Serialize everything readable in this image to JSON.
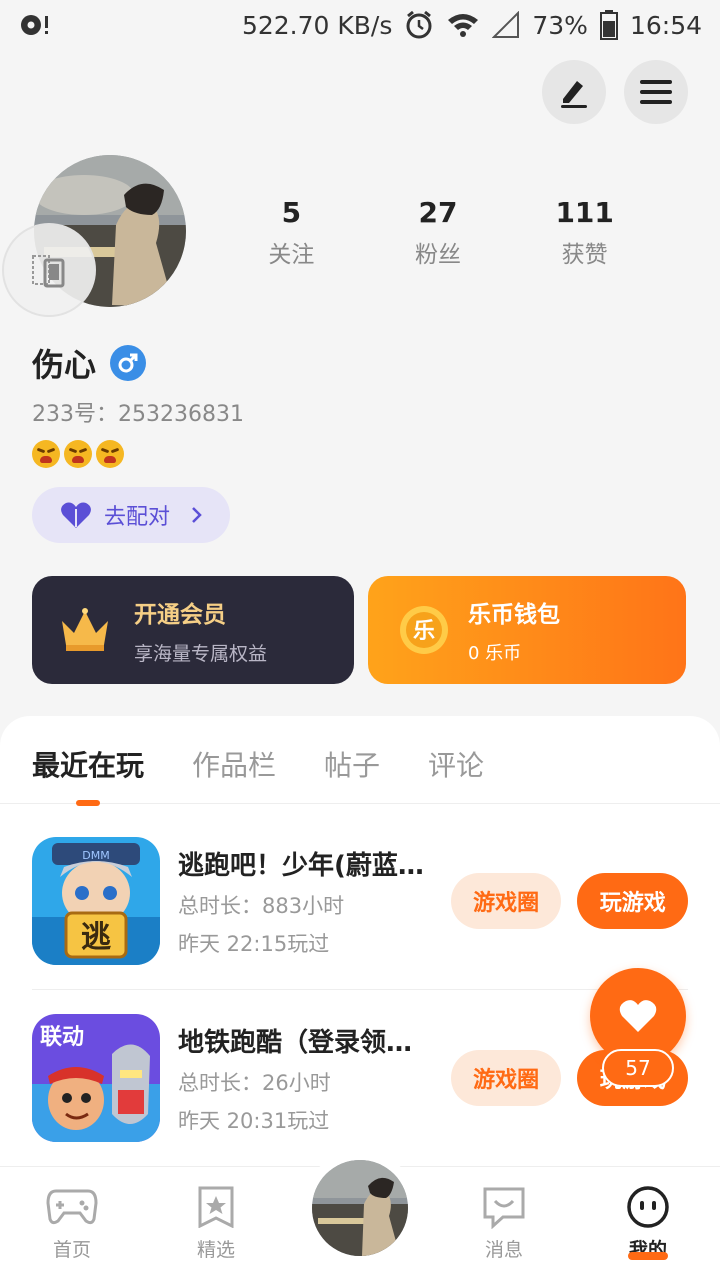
{
  "status_bar": {
    "speed": "522.70 KB/s",
    "battery": "73%",
    "time": "16:54"
  },
  "profile": {
    "following_count": "5",
    "following_label": "关注",
    "fans_count": "27",
    "fans_label": "粉丝",
    "likes_count": "111",
    "likes_label": "获赞",
    "name": "伤心",
    "uid": "233号：253236831",
    "match_label": "去配对"
  },
  "cards": {
    "vip_title": "开通会员",
    "vip_subtitle": "享海量专属权益",
    "coin_title": "乐币钱包",
    "coin_subtitle": "0 乐币",
    "coin_glyph": "乐"
  },
  "tabs": [
    {
      "label": "最近在玩",
      "active": true
    },
    {
      "label": "作品栏",
      "active": false
    },
    {
      "label": "帖子",
      "active": false
    },
    {
      "label": "评论",
      "active": false
    }
  ],
  "games": [
    {
      "title": "逃跑吧！少年(蔚蓝…",
      "duration": "总时长：883小时",
      "last_played": "昨天 22:15玩过",
      "circle_label": "游戏圈",
      "play_label": "玩游戏",
      "icon_text": "逃",
      "icon_cap_text": "DMM"
    },
    {
      "title": "地铁跑酷（登录领…",
      "duration": "总时长：26小时",
      "last_played": "昨天 20:31玩过",
      "circle_label": "游戏圈",
      "play_label": "玩游戏",
      "icon_text": "联动"
    }
  ],
  "floating_like": {
    "count": "57"
  },
  "bottom_nav": {
    "home": "首页",
    "featured": "精选",
    "messages": "消息",
    "mine": "我的"
  },
  "colors": {
    "accent": "#ff6a14",
    "vip_bg": "#2b2a3a",
    "vip_text": "#f6cf86",
    "match_bg": "#e6e4f7",
    "match_text": "#5b4fd6",
    "gender": "#3a8ee6"
  },
  "icons": [
    "edit-icon",
    "menu-icon",
    "alarm-icon",
    "wifi-icon",
    "signal-icon",
    "battery-icon",
    "gender-male-icon",
    "heart-icon",
    "crown-icon",
    "coin-icon",
    "gamepad-icon",
    "star-icon",
    "chat-icon",
    "smile-icon"
  ]
}
